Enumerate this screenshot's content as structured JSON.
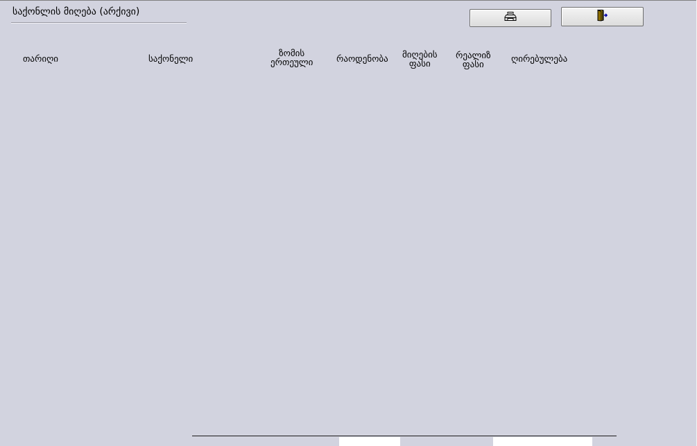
{
  "window": {
    "title": "საქონლის მიღება (არქივი)"
  },
  "toolbar": {
    "print_icon": "printer-icon",
    "exit_icon": "exit-door-icon"
  },
  "table": {
    "columns": [
      {
        "key": "date",
        "line1": "თარიღი",
        "line2": ""
      },
      {
        "key": "product",
        "line1": "საქონელი",
        "line2": ""
      },
      {
        "key": "unit",
        "line1": "ზომის",
        "line2": "ერთეული"
      },
      {
        "key": "quantity",
        "line1": "რაოდენობა",
        "line2": ""
      },
      {
        "key": "receive_price",
        "line1": "მიღების",
        "line2": "ფასი"
      },
      {
        "key": "sale_price",
        "line1": "რეალიზ",
        "line2": "ფასი"
      },
      {
        "key": "value",
        "line1": "ღირებულება",
        "line2": ""
      }
    ],
    "rows": []
  },
  "totals": {
    "quantity_total": "",
    "value_total": ""
  }
}
